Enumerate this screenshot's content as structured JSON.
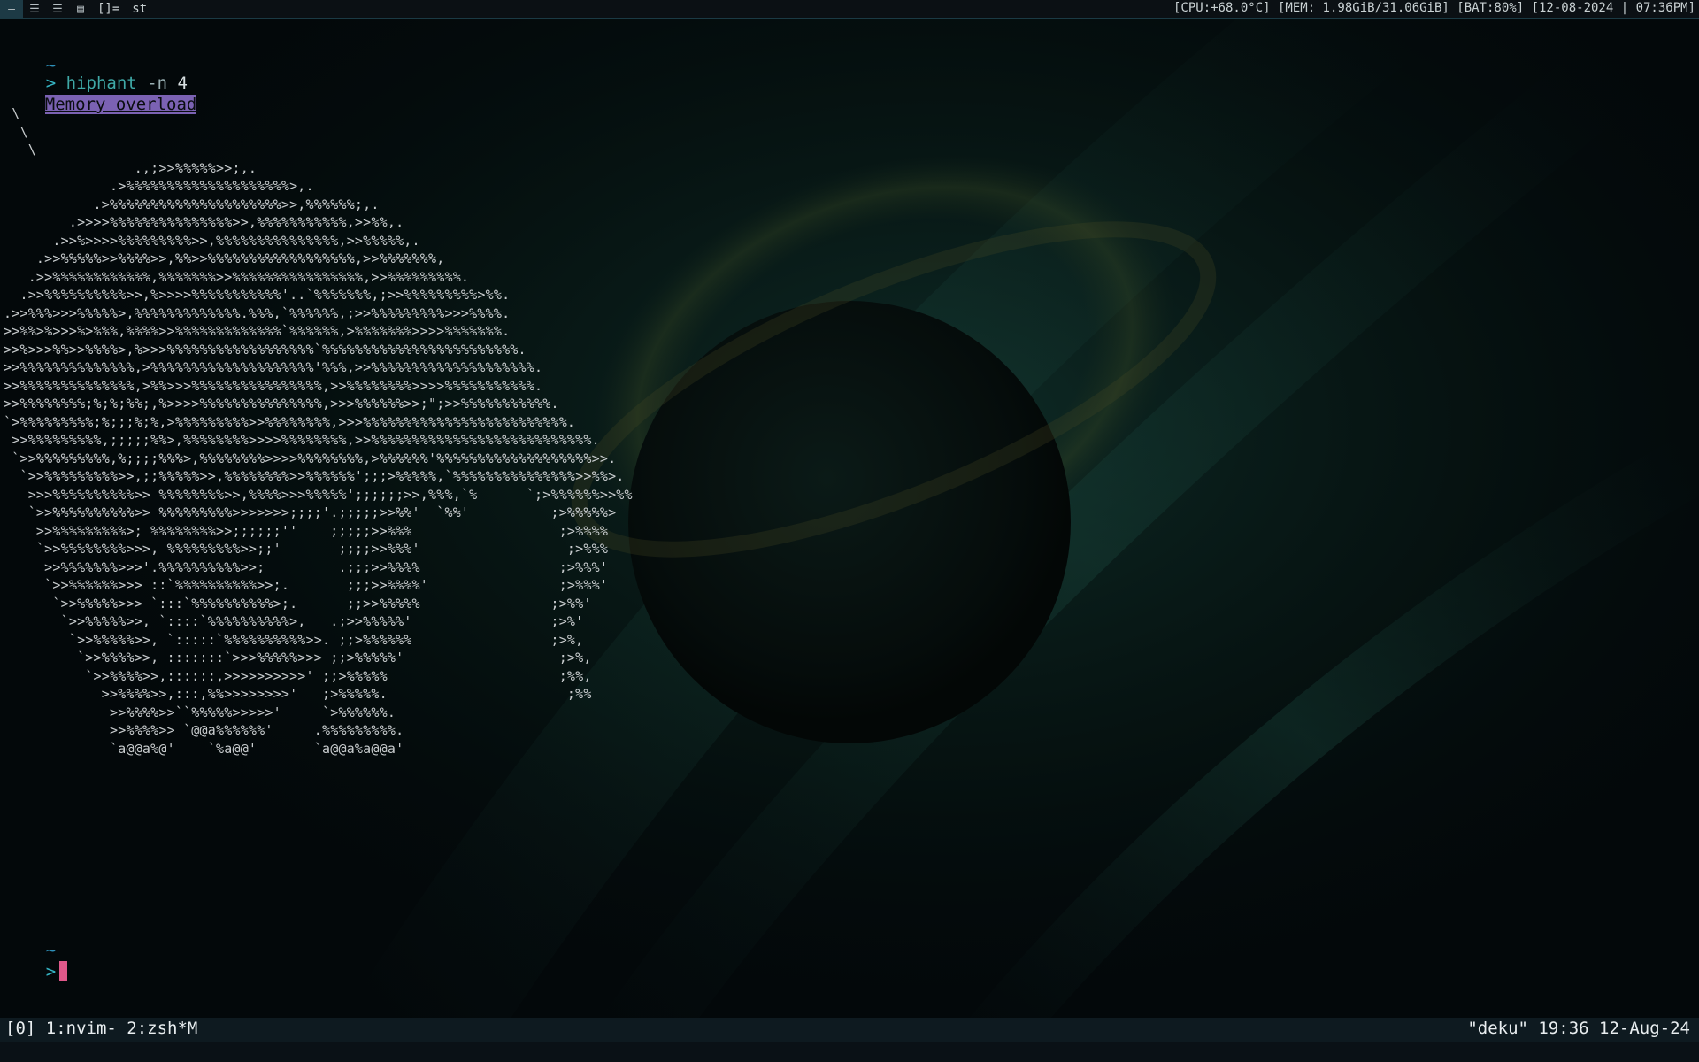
{
  "topbar": {
    "tags": [
      "—",
      "☰",
      "☰",
      "▤"
    ],
    "layout_symbol": "[]=",
    "window_title": "st",
    "status": "[CPU:+68.0°C] [MEM: 1.98GiB/31.06GiB] [BAT:80%] [12-08-2024 | 07:36PM]"
  },
  "terminal": {
    "tilde": "~",
    "prompt_symbol": ">",
    "command": {
      "name": "hiphant",
      "flag": "-n",
      "value": "4"
    },
    "speech_bubble": "Memory overload",
    "ascii_art": " \\\n  \\\n   \\\n                .,;>>%%%%%>>;,.\n             .>%%%%%%%%%%%%%%%%%%%%>,.\n           .>%%%%%%%%%%%%%%%%%%%%%>>,%%%%%%;,.\n        .>>>>%%%%%%%%%%%%%%%>>,%%%%%%%%%%%,>>%%,.\n      .>>%>>>>%%%%%%%%%>>,%%%%%%%%%%%%%%%,>>%%%%%,.\n    .>>%%%%%>>%%%%>>,%%>>%%%%%%%%%%%%%%%%%%,>>%%%%%%%,\n   .>>%%%%%%%%%%%%,%%%%%%%>>%%%%%%%%%%%%%%%%,>>%%%%%%%%%.\n  .>>%%%%%%%%%%>>,%>>>>%%%%%%%%%%%'..`%%%%%%%,;>>%%%%%%%%%>%%.\n.>>%%%>>>%%%%%>,%%%%%%%%%%%%%.%%%,`%%%%%%,;>>%%%%%%%%%>>>%%%%.\n>>%%>%>>>%>%%%,%%%%>>%%%%%%%%%%%%%`%%%%%%,>%%%%%%%>>>>%%%%%%%.\n>>%>>>%%>>%%%%>,%>>>%%%%%%%%%%%%%%%%%%`%%%%%%%%%%%%%%%%%%%%%%%%.\n>>%%%%%%%%%%%%%%,>%%%%%%%%%%%%%%%%%%%%'%%%,>>%%%%%%%%%%%%%%%%%%%%.\n>>%%%%%%%%%%%%%%,>%%>>>%%%%%%%%%%%%%%%%,>>%%%%%%%%>>>>%%%%%%%%%%%.\n>>%%%%%%%%;%;%;%%;,%>>>>%%%%%%%%%%%%%%%,>>>%%%%%%>>;\";>>%%%%%%%%%%%.\n`>%%%%%%%%%;%;;;%;%,>%%%%%%%%%>>%%%%%%%%,>>>%%%%%%%%%%%%%%%%%%%%%%%%%.\n >>%%%%%%%%%,;;;;;%%>,%%%%%%%%>>>>%%%%%%%%,>>%%%%%%%%%%%%%%%%%%%%%%%%%%%.\n `>>%%%%%%%%%,%;;;;%%%>,%%%%%%%%>>>>%%%%%%%%,>%%%%%%'%%%%%%%%%%%%%%%%%%%>>.\n  `>>%%%%%%%%%>>,;;%%%%%>>,%%%%%%%%>>%%%%%%';;;>%%%%%,`%%%%%%%%%%%%%%%>>%%>.\n   >>>%%%%%%%%%%>> %%%%%%%%>>,%%%%>>>%%%%%';;;;;;>>,%%%,`%      `;>%%%%%%>>%%\n   `>>%%%%%%%%%%>> %%%%%%%%%>>>>>>>;;;;'.;;;;;>>%%'  `%%'          ;>%%%%%>\n    >>%%%%%%%%%>; %%%%%%%%>>;;;;;;''    ;;;;;>>%%%                  ;>%%%%\n    `>>%%%%%%%%>>>, %%%%%%%%%>>;;'       ;;;;>>%%%'                  ;>%%%\n     >>%%%%%%%>>>'.%%%%%%%%%%>>;         .;;;>>%%%%                 ;>%%%'\n     `>>%%%%%%>>> ::`%%%%%%%%%%>>;.       ;;;>>%%%%'                ;>%%%'\n      `>>%%%%%>>> `:::`%%%%%%%%%%>;.      ;;>>%%%%%                ;>%%'\n       `>>%%%%%>>, `::::`%%%%%%%%%%>,   .;>>%%%%%'                 ;>%'\n        `>>%%%%%>>, `:::::`%%%%%%%%%%>>. ;;>%%%%%%                 ;>%,\n         `>>%%%%>>, :::::::`>>>%%%%%>>> ;;>%%%%%'                   ;>%,\n          `>>%%%%>>,::::::,>>>>>>>>>>' ;;>%%%%%                     ;%%,\n            >>%%%%>>,:::,%%>>>>>>>>'   ;>%%%%%.                      ;%%\n             >>%%%%>>``%%%%%>>>>>'     `>%%%%%%.\n             >>%%%%>> `@@a%%%%%%'     .%%%%%%%%%.\n             `a@@a%@'    `%a@@'       `a@@a%a@@a'",
    "second_tilde": "~",
    "second_prompt_symbol": ">"
  },
  "tmux": {
    "left": "[0] 1:nvim- 2:zsh*M",
    "right": "\"deku\" 19:36 12-Aug-24"
  },
  "colors": {
    "accent_purple": "#7b62b3",
    "cursor_pink": "#e0588a",
    "prompt_cyan": "#35b4c4",
    "topbar_bg": "#0b1014"
  }
}
